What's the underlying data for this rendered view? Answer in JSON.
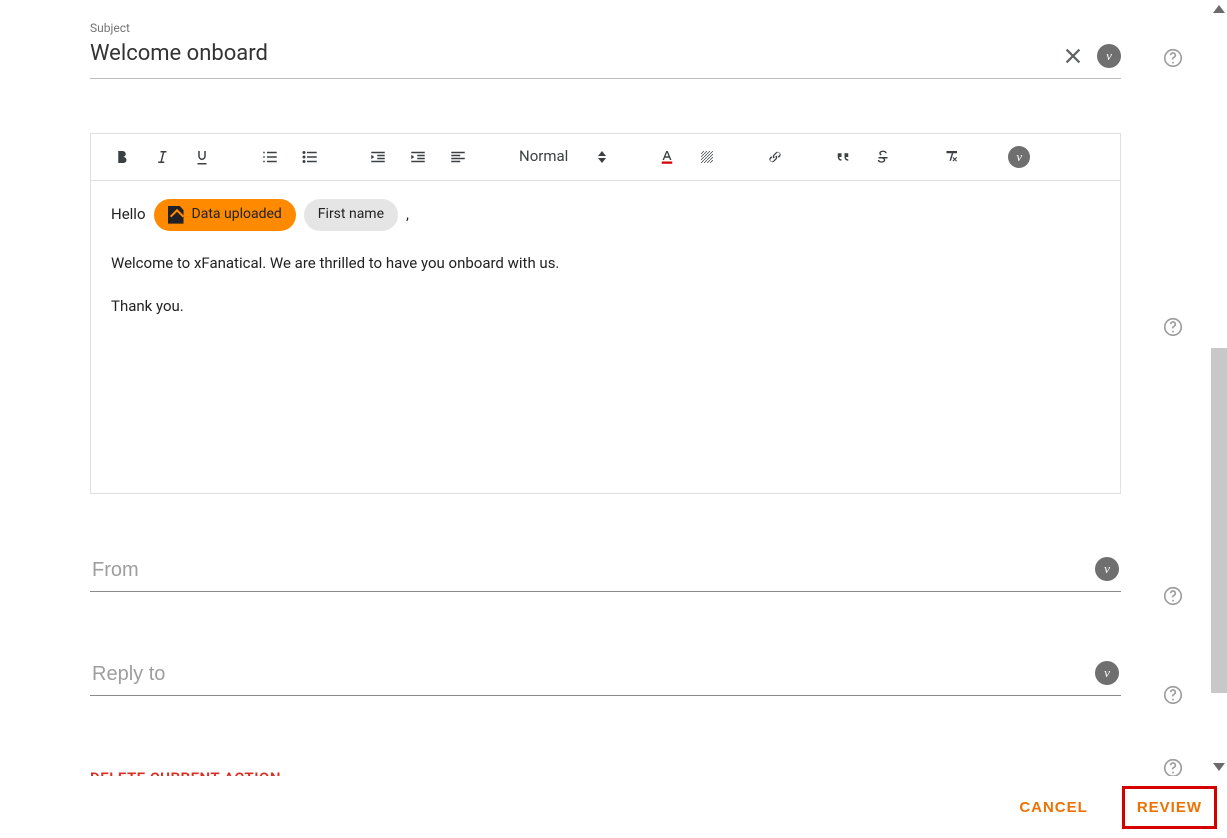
{
  "subject": {
    "label": "Subject",
    "value": "Welcome onboard"
  },
  "toolbar": {
    "format_select": "Normal"
  },
  "chips": {
    "data_uploaded": "Data uploaded",
    "first_name": "First name"
  },
  "body": {
    "hello": "Hello",
    "comma": ",",
    "p1": "Welcome to xFanatical. We are thrilled to have you onboard with us.",
    "p2": "Thank you."
  },
  "fields": {
    "from_placeholder": "From",
    "reply_to_placeholder": "Reply to"
  },
  "delete_action_hint": "DELETE CURRENT ACTION",
  "buttons": {
    "cancel": "CANCEL",
    "review": "REVIEW"
  },
  "badge_letter": "v"
}
